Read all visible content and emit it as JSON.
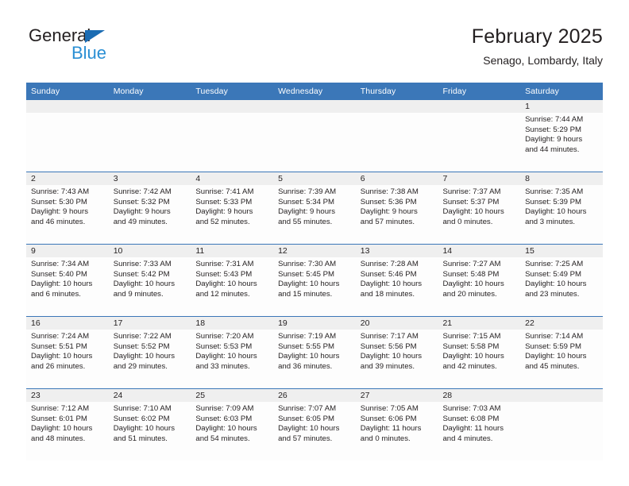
{
  "brand": {
    "name_part1": "General",
    "name_part2": "Blue",
    "triangle_icon": "brand-triangle-icon",
    "accent_color": "#2a8fd4",
    "dark_color": "#231f20"
  },
  "header": {
    "title": "February 2025",
    "subtitle": "Senago, Lombardy, Italy"
  },
  "calendar": {
    "header_color": "#3b77b8",
    "daynum_band_color": "#efefef",
    "weekday_headers": [
      "Sunday",
      "Monday",
      "Tuesday",
      "Wednesday",
      "Thursday",
      "Friday",
      "Saturday"
    ],
    "weeks": [
      [
        {
          "day": "",
          "blank": true,
          "sunrise": "",
          "sunset": "",
          "daylight_line1": "",
          "daylight_line2": ""
        },
        {
          "day": "",
          "blank": true,
          "sunrise": "",
          "sunset": "",
          "daylight_line1": "",
          "daylight_line2": ""
        },
        {
          "day": "",
          "blank": true,
          "sunrise": "",
          "sunset": "",
          "daylight_line1": "",
          "daylight_line2": ""
        },
        {
          "day": "",
          "blank": true,
          "sunrise": "",
          "sunset": "",
          "daylight_line1": "",
          "daylight_line2": ""
        },
        {
          "day": "",
          "blank": true,
          "sunrise": "",
          "sunset": "",
          "daylight_line1": "",
          "daylight_line2": ""
        },
        {
          "day": "",
          "blank": true,
          "sunrise": "",
          "sunset": "",
          "daylight_line1": "",
          "daylight_line2": ""
        },
        {
          "day": "1",
          "blank": false,
          "sunrise": "Sunrise: 7:44 AM",
          "sunset": "Sunset: 5:29 PM",
          "daylight_line1": "Daylight: 9 hours",
          "daylight_line2": "and 44 minutes."
        }
      ],
      [
        {
          "day": "2",
          "blank": false,
          "sunrise": "Sunrise: 7:43 AM",
          "sunset": "Sunset: 5:30 PM",
          "daylight_line1": "Daylight: 9 hours",
          "daylight_line2": "and 46 minutes."
        },
        {
          "day": "3",
          "blank": false,
          "sunrise": "Sunrise: 7:42 AM",
          "sunset": "Sunset: 5:32 PM",
          "daylight_line1": "Daylight: 9 hours",
          "daylight_line2": "and 49 minutes."
        },
        {
          "day": "4",
          "blank": false,
          "sunrise": "Sunrise: 7:41 AM",
          "sunset": "Sunset: 5:33 PM",
          "daylight_line1": "Daylight: 9 hours",
          "daylight_line2": "and 52 minutes."
        },
        {
          "day": "5",
          "blank": false,
          "sunrise": "Sunrise: 7:39 AM",
          "sunset": "Sunset: 5:34 PM",
          "daylight_line1": "Daylight: 9 hours",
          "daylight_line2": "and 55 minutes."
        },
        {
          "day": "6",
          "blank": false,
          "sunrise": "Sunrise: 7:38 AM",
          "sunset": "Sunset: 5:36 PM",
          "daylight_line1": "Daylight: 9 hours",
          "daylight_line2": "and 57 minutes."
        },
        {
          "day": "7",
          "blank": false,
          "sunrise": "Sunrise: 7:37 AM",
          "sunset": "Sunset: 5:37 PM",
          "daylight_line1": "Daylight: 10 hours",
          "daylight_line2": "and 0 minutes."
        },
        {
          "day": "8",
          "blank": false,
          "sunrise": "Sunrise: 7:35 AM",
          "sunset": "Sunset: 5:39 PM",
          "daylight_line1": "Daylight: 10 hours",
          "daylight_line2": "and 3 minutes."
        }
      ],
      [
        {
          "day": "9",
          "blank": false,
          "sunrise": "Sunrise: 7:34 AM",
          "sunset": "Sunset: 5:40 PM",
          "daylight_line1": "Daylight: 10 hours",
          "daylight_line2": "and 6 minutes."
        },
        {
          "day": "10",
          "blank": false,
          "sunrise": "Sunrise: 7:33 AM",
          "sunset": "Sunset: 5:42 PM",
          "daylight_line1": "Daylight: 10 hours",
          "daylight_line2": "and 9 minutes."
        },
        {
          "day": "11",
          "blank": false,
          "sunrise": "Sunrise: 7:31 AM",
          "sunset": "Sunset: 5:43 PM",
          "daylight_line1": "Daylight: 10 hours",
          "daylight_line2": "and 12 minutes."
        },
        {
          "day": "12",
          "blank": false,
          "sunrise": "Sunrise: 7:30 AM",
          "sunset": "Sunset: 5:45 PM",
          "daylight_line1": "Daylight: 10 hours",
          "daylight_line2": "and 15 minutes."
        },
        {
          "day": "13",
          "blank": false,
          "sunrise": "Sunrise: 7:28 AM",
          "sunset": "Sunset: 5:46 PM",
          "daylight_line1": "Daylight: 10 hours",
          "daylight_line2": "and 18 minutes."
        },
        {
          "day": "14",
          "blank": false,
          "sunrise": "Sunrise: 7:27 AM",
          "sunset": "Sunset: 5:48 PM",
          "daylight_line1": "Daylight: 10 hours",
          "daylight_line2": "and 20 minutes."
        },
        {
          "day": "15",
          "blank": false,
          "sunrise": "Sunrise: 7:25 AM",
          "sunset": "Sunset: 5:49 PM",
          "daylight_line1": "Daylight: 10 hours",
          "daylight_line2": "and 23 minutes."
        }
      ],
      [
        {
          "day": "16",
          "blank": false,
          "sunrise": "Sunrise: 7:24 AM",
          "sunset": "Sunset: 5:51 PM",
          "daylight_line1": "Daylight: 10 hours",
          "daylight_line2": "and 26 minutes."
        },
        {
          "day": "17",
          "blank": false,
          "sunrise": "Sunrise: 7:22 AM",
          "sunset": "Sunset: 5:52 PM",
          "daylight_line1": "Daylight: 10 hours",
          "daylight_line2": "and 29 minutes."
        },
        {
          "day": "18",
          "blank": false,
          "sunrise": "Sunrise: 7:20 AM",
          "sunset": "Sunset: 5:53 PM",
          "daylight_line1": "Daylight: 10 hours",
          "daylight_line2": "and 33 minutes."
        },
        {
          "day": "19",
          "blank": false,
          "sunrise": "Sunrise: 7:19 AM",
          "sunset": "Sunset: 5:55 PM",
          "daylight_line1": "Daylight: 10 hours",
          "daylight_line2": "and 36 minutes."
        },
        {
          "day": "20",
          "blank": false,
          "sunrise": "Sunrise: 7:17 AM",
          "sunset": "Sunset: 5:56 PM",
          "daylight_line1": "Daylight: 10 hours",
          "daylight_line2": "and 39 minutes."
        },
        {
          "day": "21",
          "blank": false,
          "sunrise": "Sunrise: 7:15 AM",
          "sunset": "Sunset: 5:58 PM",
          "daylight_line1": "Daylight: 10 hours",
          "daylight_line2": "and 42 minutes."
        },
        {
          "day": "22",
          "blank": false,
          "sunrise": "Sunrise: 7:14 AM",
          "sunset": "Sunset: 5:59 PM",
          "daylight_line1": "Daylight: 10 hours",
          "daylight_line2": "and 45 minutes."
        }
      ],
      [
        {
          "day": "23",
          "blank": false,
          "sunrise": "Sunrise: 7:12 AM",
          "sunset": "Sunset: 6:01 PM",
          "daylight_line1": "Daylight: 10 hours",
          "daylight_line2": "and 48 minutes."
        },
        {
          "day": "24",
          "blank": false,
          "sunrise": "Sunrise: 7:10 AM",
          "sunset": "Sunset: 6:02 PM",
          "daylight_line1": "Daylight: 10 hours",
          "daylight_line2": "and 51 minutes."
        },
        {
          "day": "25",
          "blank": false,
          "sunrise": "Sunrise: 7:09 AM",
          "sunset": "Sunset: 6:03 PM",
          "daylight_line1": "Daylight: 10 hours",
          "daylight_line2": "and 54 minutes."
        },
        {
          "day": "26",
          "blank": false,
          "sunrise": "Sunrise: 7:07 AM",
          "sunset": "Sunset: 6:05 PM",
          "daylight_line1": "Daylight: 10 hours",
          "daylight_line2": "and 57 minutes."
        },
        {
          "day": "27",
          "blank": false,
          "sunrise": "Sunrise: 7:05 AM",
          "sunset": "Sunset: 6:06 PM",
          "daylight_line1": "Daylight: 11 hours",
          "daylight_line2": "and 0 minutes."
        },
        {
          "day": "28",
          "blank": false,
          "sunrise": "Sunrise: 7:03 AM",
          "sunset": "Sunset: 6:08 PM",
          "daylight_line1": "Daylight: 11 hours",
          "daylight_line2": "and 4 minutes."
        },
        {
          "day": "",
          "blank": true,
          "sunrise": "",
          "sunset": "",
          "daylight_line1": "",
          "daylight_line2": ""
        }
      ]
    ]
  }
}
